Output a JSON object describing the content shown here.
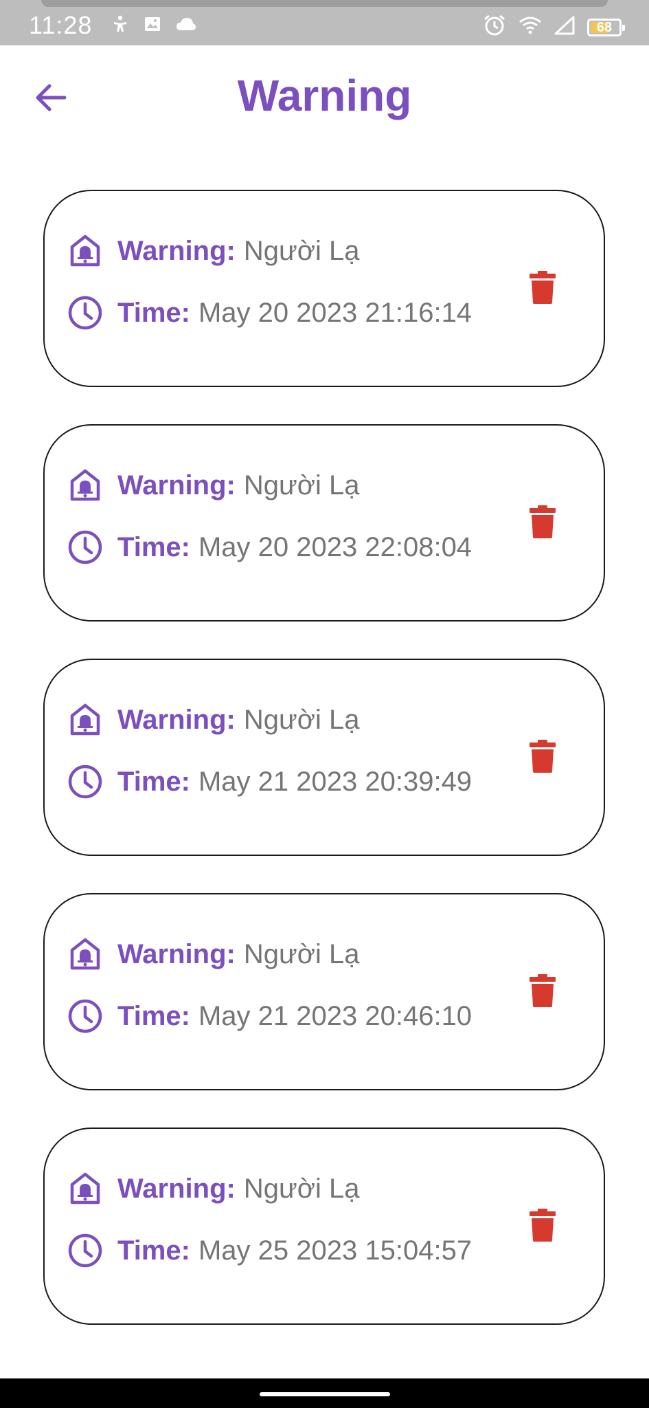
{
  "status_bar": {
    "time": "11:28",
    "left_icons": [
      "accessibility-icon",
      "image-icon",
      "cloud-icon"
    ],
    "right_icons": [
      "alarm-icon",
      "wifi-icon",
      "signal-icon"
    ],
    "battery_level": "68"
  },
  "header": {
    "title": "Warning",
    "back_icon": "arrow-left-icon"
  },
  "warnings": [
    {
      "warning_label": "Warning:",
      "warning_value": "Người Lạ",
      "time_label": "Time:",
      "time_value": "May 20 2023 21:16:14"
    },
    {
      "warning_label": "Warning:",
      "warning_value": "Người Lạ",
      "time_label": "Time:",
      "time_value": "May 20 2023 22:08:04"
    },
    {
      "warning_label": "Warning:",
      "warning_value": "Người Lạ",
      "time_label": "Time:",
      "time_value": "May 21 2023 20:39:49"
    },
    {
      "warning_label": "Warning:",
      "warning_value": "Người Lạ",
      "time_label": "Time:",
      "time_value": "May 21 2023 20:46:10"
    },
    {
      "warning_label": "Warning:",
      "warning_value": "Người Lạ",
      "time_label": "Time:",
      "time_value": "May 25 2023 15:04:57"
    }
  ],
  "colors": {
    "accent": "#7b4fbd",
    "delete": "#d63a2f",
    "value_text": "#757575"
  }
}
